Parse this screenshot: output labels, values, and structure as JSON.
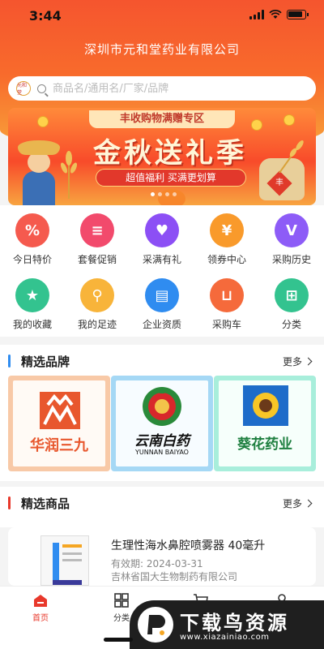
{
  "status_bar": {
    "time": "3:44"
  },
  "header": {
    "company_name": "深圳市元和堂药业有限公司",
    "search_placeholder": "商品名/通用名/厂家/品牌",
    "logo_text": "元和堂"
  },
  "banner": {
    "top_label": "丰收购物满赠专区",
    "title": "金秋送礼季",
    "subtitle": "超值福利 买满更划算",
    "sack_text": "丰",
    "slide_count": 4,
    "active_slide": 1
  },
  "quick_menu": [
    {
      "label": "今日特价",
      "icon": "tag-icon",
      "color": "#f55a4e",
      "glyph": "%"
    },
    {
      "label": "套餐促销",
      "icon": "stack-icon",
      "color": "#f24a6c",
      "glyph": "≡"
    },
    {
      "label": "采满有礼",
      "icon": "gift-icon",
      "color": "#8c4ff5",
      "glyph": "♥"
    },
    {
      "label": "领券中心",
      "icon": "coupon-icon",
      "color": "#f99a2b",
      "glyph": "¥"
    },
    {
      "label": "采购历史",
      "icon": "history-icon",
      "color": "#8d5cf7",
      "glyph": "V"
    },
    {
      "label": "我的收藏",
      "icon": "star-icon",
      "color": "#33c38f",
      "glyph": "★"
    },
    {
      "label": "我的足迹",
      "icon": "footprint-icon",
      "color": "#f8b43a",
      "glyph": "⚲"
    },
    {
      "label": "企业资质",
      "icon": "certificate-icon",
      "color": "#2f8cf0",
      "glyph": "▤"
    },
    {
      "label": "采购车",
      "icon": "cart-icon",
      "color": "#f56a3b",
      "glyph": "⊔"
    },
    {
      "label": "分类",
      "icon": "category-icon",
      "color": "#33c38f",
      "glyph": "⊞"
    }
  ],
  "brands_section": {
    "title": "精选品牌",
    "more_label": "更多",
    "accent": "#2f8cf0",
    "brands": [
      {
        "name": "华润三九",
        "border_color": "#f8c9a7",
        "text_color": "#e8572d"
      },
      {
        "name": "云南白药",
        "name_en": "YUNNAN BAIYAO",
        "border_color": "#a5d8f5",
        "text_color": "#111111"
      },
      {
        "name": "葵花药业",
        "border_color": "#a8eedb",
        "text_color": "#1d7f3f"
      }
    ]
  },
  "products_section": {
    "title": "精选商品",
    "more_label": "更多",
    "accent": "#e8382b",
    "products": [
      {
        "name": "生理性海水鼻腔喷雾器 40毫升",
        "expiry_label": "有效期:",
        "expiry": "2024-03-31",
        "manufacturer": "吉林省国大生物制药有限公司"
      }
    ]
  },
  "tab_bar": {
    "tabs": [
      {
        "label": "首页",
        "icon": "home-icon",
        "active": true
      },
      {
        "label": "分类",
        "icon": "category-icon",
        "active": false
      },
      {
        "label": "",
        "icon": "cart-icon",
        "active": false
      },
      {
        "label": "",
        "icon": "profile-icon",
        "active": false
      }
    ]
  },
  "watermark": {
    "title": "下载鸟资源",
    "url": "www.xiazainiao.com"
  }
}
